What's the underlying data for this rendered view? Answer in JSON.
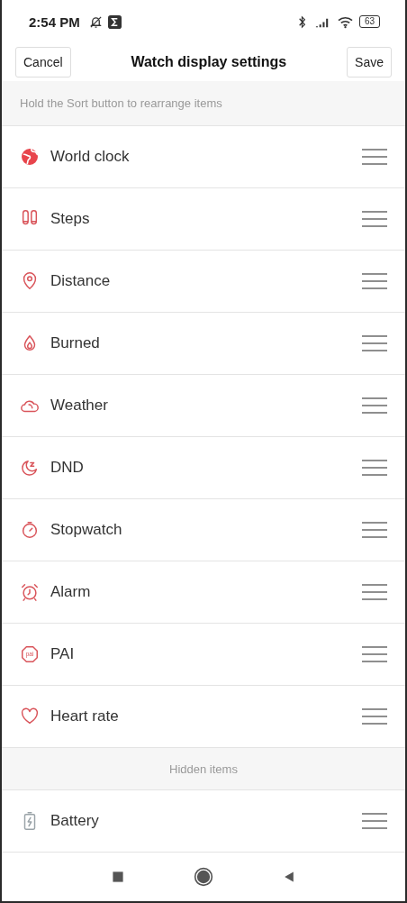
{
  "status_bar": {
    "time": "2:54 PM",
    "battery": "63"
  },
  "header": {
    "cancel": "Cancel",
    "title": "Watch display settings",
    "save": "Save"
  },
  "hint": "Hold the Sort button to rearrange items",
  "items": [
    {
      "label": "World clock",
      "kind": "globe"
    },
    {
      "label": "Steps",
      "kind": "footprints"
    },
    {
      "label": "Distance",
      "kind": "pin"
    },
    {
      "label": "Burned",
      "kind": "flame"
    },
    {
      "label": "Weather",
      "kind": "cloud"
    },
    {
      "label": "DND",
      "kind": "moon"
    },
    {
      "label": "Stopwatch",
      "kind": "stopwatch"
    },
    {
      "label": "Alarm",
      "kind": "alarm"
    },
    {
      "label": "PAI",
      "kind": "pai",
      "icon_text": "pai"
    },
    {
      "label": "Heart rate",
      "kind": "heart"
    }
  ],
  "hidden_section": {
    "title": "Hidden items",
    "items": [
      {
        "label": "Battery",
        "kind": "battery"
      }
    ]
  }
}
